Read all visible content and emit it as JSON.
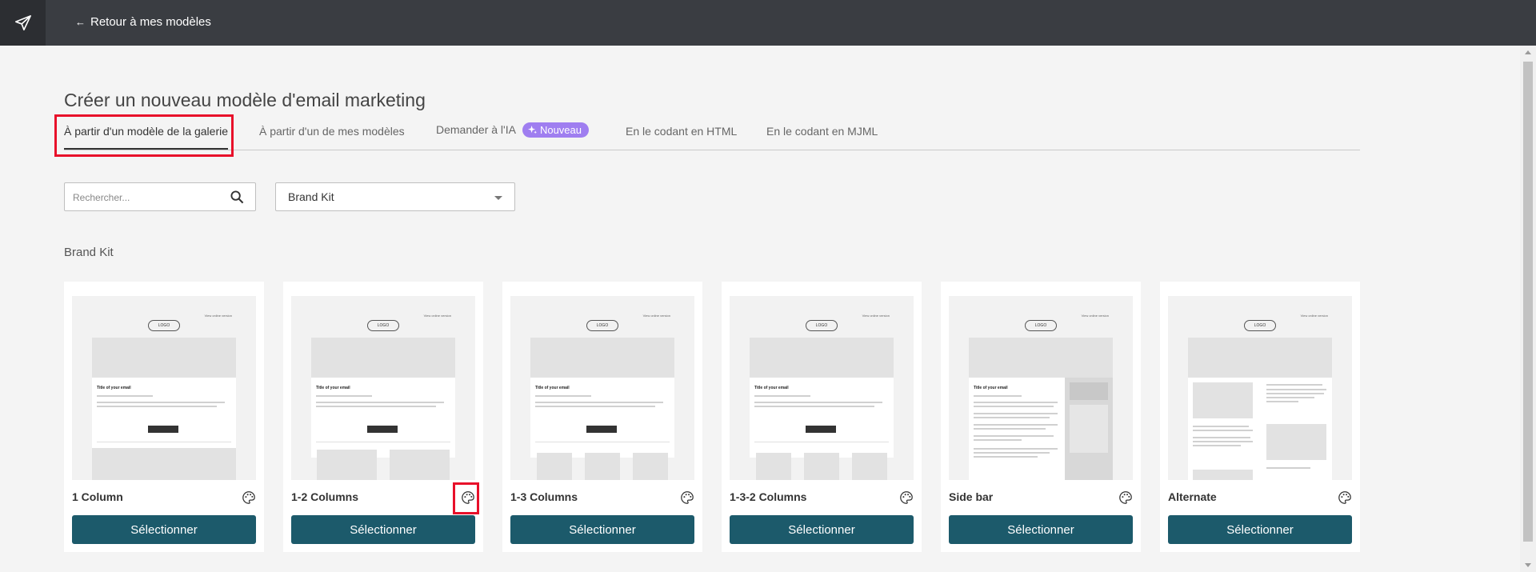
{
  "header": {
    "back_label": "Retour à mes modèles"
  },
  "page": {
    "title": "Créer un nouveau modèle d'email marketing"
  },
  "tabs": [
    {
      "label": "À partir d'un modèle de la galerie",
      "active": true
    },
    {
      "label": "À partir d'un de mes modèles",
      "active": false
    },
    {
      "label": "Demander à l'IA",
      "badge": "Nouveau",
      "active": false
    },
    {
      "label": "En le codant en HTML",
      "active": false
    },
    {
      "label": "En le codant en MJML",
      "active": false
    }
  ],
  "search": {
    "placeholder": "Rechercher..."
  },
  "filter": {
    "value": "Brand Kit"
  },
  "section": {
    "title": "Brand Kit"
  },
  "thumbnail_text": {
    "view_online": "View online version",
    "logo": "LOGO",
    "heading": "Title of your email"
  },
  "templates": [
    {
      "name": "1 Column",
      "button": "Sélectionner"
    },
    {
      "name": "1-2 Columns",
      "button": "Sélectionner"
    },
    {
      "name": "1-3 Columns",
      "button": "Sélectionner"
    },
    {
      "name": "1-3-2 Columns",
      "button": "Sélectionner"
    },
    {
      "name": "Side bar",
      "button": "Sélectionner"
    },
    {
      "name": "Alternate",
      "button": "Sélectionner"
    }
  ],
  "colors": {
    "topbar": "#3a3d42",
    "accent_button": "#1c5a6b",
    "badge": "#9f7ef0",
    "highlight": "#e8102a"
  },
  "icons": {
    "app_logo": "paper-plane-icon",
    "back": "arrow-left-icon",
    "search": "search-icon",
    "palette": "palette-icon",
    "badge": "sparkle-icon"
  }
}
